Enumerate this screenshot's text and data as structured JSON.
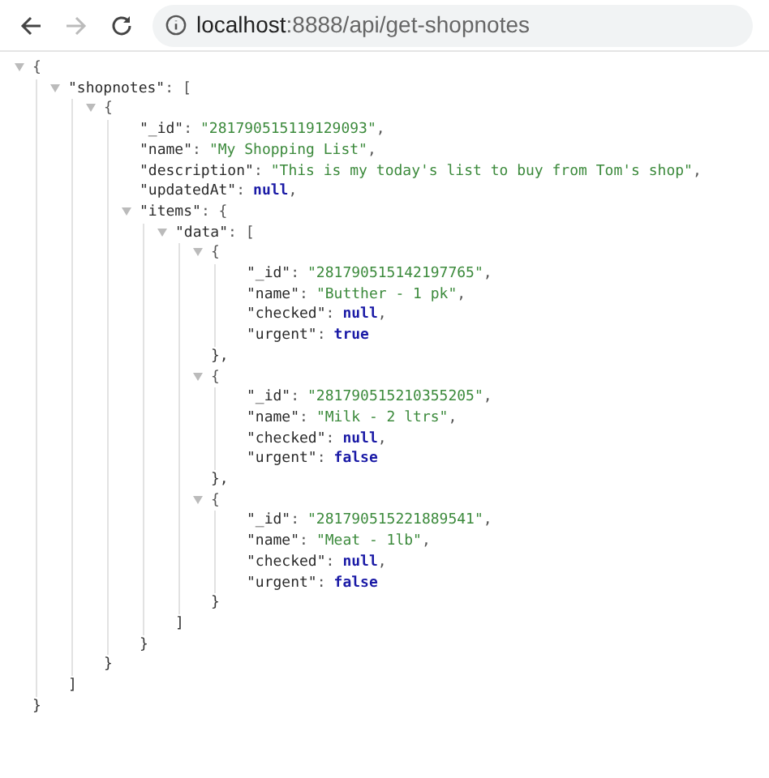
{
  "toolbar": {
    "url_host": "localhost",
    "url_path": ":8888/api/get-shopnotes"
  },
  "tree": {
    "expanded": true,
    "tokens": [
      {
        "kind": "punct",
        "text": "{"
      }
    ],
    "close": "}",
    "children": [
      {
        "expanded": true,
        "tokens": [
          {
            "kind": "key",
            "text": "\"shopnotes\""
          },
          {
            "kind": "punct",
            "text": ": ["
          }
        ],
        "close": "]",
        "children": [
          {
            "expanded": true,
            "tokens": [
              {
                "kind": "punct",
                "text": "{"
              }
            ],
            "close": "}",
            "children": [
              {
                "tokens": [
                  {
                    "kind": "key",
                    "text": "\"_id\""
                  },
                  {
                    "kind": "punct",
                    "text": ":"
                  },
                  {
                    "kind": "string",
                    "text": "\"281790515119129093\""
                  },
                  {
                    "kind": "punct",
                    "text": ","
                  }
                ]
              },
              {
                "tokens": [
                  {
                    "kind": "key",
                    "text": "\"name\""
                  },
                  {
                    "kind": "punct",
                    "text": ":"
                  },
                  {
                    "kind": "string",
                    "text": "\"My Shopping List\""
                  },
                  {
                    "kind": "punct",
                    "text": ","
                  }
                ]
              },
              {
                "tokens": [
                  {
                    "kind": "key",
                    "text": "\"description\""
                  },
                  {
                    "kind": "punct",
                    "text": ":"
                  },
                  {
                    "kind": "string",
                    "text": "\"This is my today's list to buy from Tom's shop\""
                  },
                  {
                    "kind": "punct",
                    "text": ","
                  }
                ]
              },
              {
                "tokens": [
                  {
                    "kind": "key",
                    "text": "\"updatedAt\""
                  },
                  {
                    "kind": "punct",
                    "text": ":"
                  },
                  {
                    "kind": "literal",
                    "text": "null"
                  },
                  {
                    "kind": "punct",
                    "text": ","
                  }
                ]
              },
              {
                "expanded": true,
                "tokens": [
                  {
                    "kind": "key",
                    "text": "\"items\""
                  },
                  {
                    "kind": "punct",
                    "text": ": {"
                  }
                ],
                "close": "}",
                "children": [
                  {
                    "expanded": true,
                    "tokens": [
                      {
                        "kind": "key",
                        "text": "\"data\""
                      },
                      {
                        "kind": "punct",
                        "text": ": ["
                      }
                    ],
                    "close": "]",
                    "children": [
                      {
                        "expanded": true,
                        "tokens": [
                          {
                            "kind": "punct",
                            "text": "{"
                          }
                        ],
                        "close": "},",
                        "children": [
                          {
                            "tokens": [
                              {
                                "kind": "key",
                                "text": "\"_id\""
                              },
                              {
                                "kind": "punct",
                                "text": ":"
                              },
                              {
                                "kind": "string",
                                "text": "\"281790515142197765\""
                              },
                              {
                                "kind": "punct",
                                "text": ","
                              }
                            ]
                          },
                          {
                            "tokens": [
                              {
                                "kind": "key",
                                "text": "\"name\""
                              },
                              {
                                "kind": "punct",
                                "text": ":"
                              },
                              {
                                "kind": "string",
                                "text": "\"Butther - 1 pk\""
                              },
                              {
                                "kind": "punct",
                                "text": ","
                              }
                            ]
                          },
                          {
                            "tokens": [
                              {
                                "kind": "key",
                                "text": "\"checked\""
                              },
                              {
                                "kind": "punct",
                                "text": ":"
                              },
                              {
                                "kind": "literal",
                                "text": "null"
                              },
                              {
                                "kind": "punct",
                                "text": ","
                              }
                            ]
                          },
                          {
                            "tokens": [
                              {
                                "kind": "key",
                                "text": "\"urgent\""
                              },
                              {
                                "kind": "punct",
                                "text": ":"
                              },
                              {
                                "kind": "literal",
                                "text": "true"
                              }
                            ]
                          }
                        ]
                      },
                      {
                        "expanded": true,
                        "tokens": [
                          {
                            "kind": "punct",
                            "text": "{"
                          }
                        ],
                        "close": "},",
                        "children": [
                          {
                            "tokens": [
                              {
                                "kind": "key",
                                "text": "\"_id\""
                              },
                              {
                                "kind": "punct",
                                "text": ":"
                              },
                              {
                                "kind": "string",
                                "text": "\"281790515210355205\""
                              },
                              {
                                "kind": "punct",
                                "text": ","
                              }
                            ]
                          },
                          {
                            "tokens": [
                              {
                                "kind": "key",
                                "text": "\"name\""
                              },
                              {
                                "kind": "punct",
                                "text": ":"
                              },
                              {
                                "kind": "string",
                                "text": "\"Milk - 2 ltrs\""
                              },
                              {
                                "kind": "punct",
                                "text": ","
                              }
                            ]
                          },
                          {
                            "tokens": [
                              {
                                "kind": "key",
                                "text": "\"checked\""
                              },
                              {
                                "kind": "punct",
                                "text": ":"
                              },
                              {
                                "kind": "literal",
                                "text": "null"
                              },
                              {
                                "kind": "punct",
                                "text": ","
                              }
                            ]
                          },
                          {
                            "tokens": [
                              {
                                "kind": "key",
                                "text": "\"urgent\""
                              },
                              {
                                "kind": "punct",
                                "text": ":"
                              },
                              {
                                "kind": "literal",
                                "text": "false"
                              }
                            ]
                          }
                        ]
                      },
                      {
                        "expanded": true,
                        "tokens": [
                          {
                            "kind": "punct",
                            "text": "{"
                          }
                        ],
                        "close": "}",
                        "children": [
                          {
                            "tokens": [
                              {
                                "kind": "key",
                                "text": "\"_id\""
                              },
                              {
                                "kind": "punct",
                                "text": ":"
                              },
                              {
                                "kind": "string",
                                "text": "\"281790515221889541\""
                              },
                              {
                                "kind": "punct",
                                "text": ","
                              }
                            ]
                          },
                          {
                            "tokens": [
                              {
                                "kind": "key",
                                "text": "\"name\""
                              },
                              {
                                "kind": "punct",
                                "text": ":"
                              },
                              {
                                "kind": "string",
                                "text": "\"Meat - 1lb\""
                              },
                              {
                                "kind": "punct",
                                "text": ","
                              }
                            ]
                          },
                          {
                            "tokens": [
                              {
                                "kind": "key",
                                "text": "\"checked\""
                              },
                              {
                                "kind": "punct",
                                "text": ":"
                              },
                              {
                                "kind": "literal",
                                "text": "null"
                              },
                              {
                                "kind": "punct",
                                "text": ","
                              }
                            ]
                          },
                          {
                            "tokens": [
                              {
                                "kind": "key",
                                "text": "\"urgent\""
                              },
                              {
                                "kind": "punct",
                                "text": ":"
                              },
                              {
                                "kind": "literal",
                                "text": "false"
                              }
                            ]
                          }
                        ]
                      }
                    ]
                  }
                ]
              }
            ]
          }
        ]
      }
    ]
  }
}
